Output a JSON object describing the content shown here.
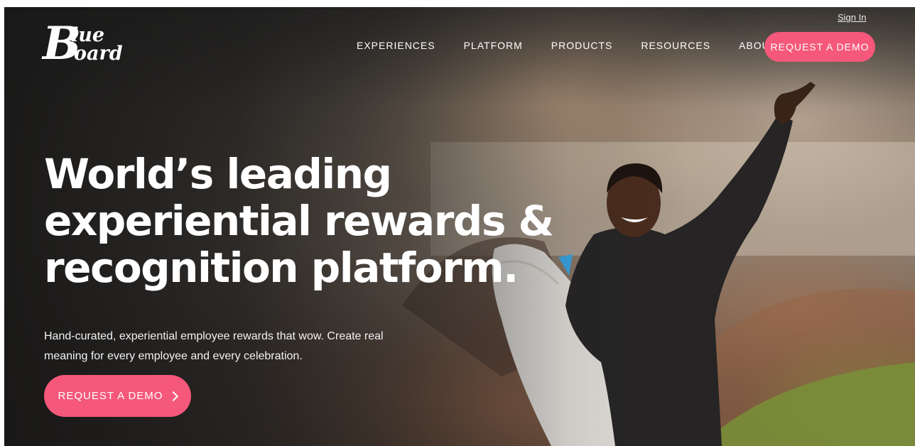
{
  "header": {
    "sign_in": "Sign In",
    "logo_text": "Blueboard",
    "logo_parts": {
      "b": "B",
      "lue": "lue",
      "oard": "oard"
    },
    "nav": [
      {
        "label": "EXPERIENCES"
      },
      {
        "label": "PLATFORM"
      },
      {
        "label": "PRODUCTS"
      },
      {
        "label": "RESOURCES"
      },
      {
        "label": "ABOUT"
      }
    ],
    "cta_label": "REQUEST A DEMO"
  },
  "hero": {
    "headline_lines": [
      "World’s leading",
      "experiential rewards &",
      "recognition platform."
    ],
    "subtext": "Hand-curated, experiential employee rewards that wow. Create real meaning for every employee and every celebration.",
    "cta_label": "REQUEST A DEMO",
    "cta_icon": "chevron-right-icon"
  },
  "colors": {
    "accent": "#f5587a",
    "text_on_dark": "#ffffff"
  }
}
